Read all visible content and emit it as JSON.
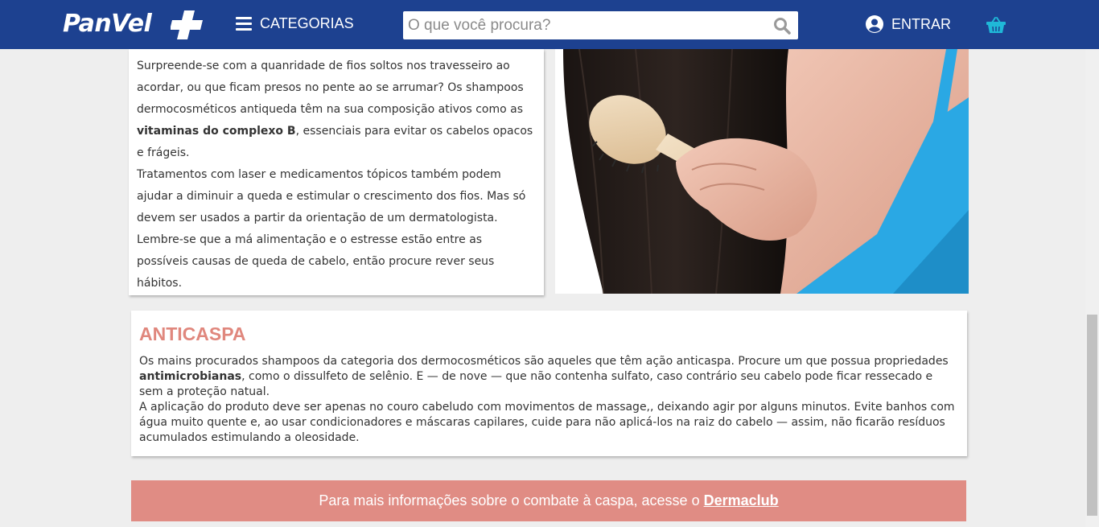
{
  "header": {
    "logo": "PanVel",
    "categories_label": "CATEGORIAS",
    "search_placeholder": "O que você procura?",
    "login_label": "ENTRAR"
  },
  "colors": {
    "header_bg": "#1d4190",
    "accent_salmon": "#e0877d",
    "cart_cyan": "#1fb8d8"
  },
  "icons": [
    "menu-icon",
    "search-icon",
    "user-icon",
    "basket-icon"
  ],
  "hair_loss_section": {
    "p1_a": "Surpreende-se com a quanridade de fios soltos nos travesseiro ao acordar, ou que ficam presos no pente ao se arrumar? Os shampoos dermocosméticos antiqueda têm na sua composição ativos como as ",
    "p1_bold": "vitaminas do complexo B",
    "p1_b": ", essenciais para evitar os cabelos opacos e frágeis.",
    "p2": "Tratamentos com laser e medicamentos tópicos também podem ajudar a diminuir a queda e estimular o crescimento dos fios. Mas só devem ser usados a partir da orientação de um dermatologista. Lembre-se que a má alimentação e o estresse estão entre as possíveis causas de queda de cabelo, então procure rever seus hábitos."
  },
  "anticaspa": {
    "title": "ANTICASPA",
    "p1_a": "Os mains procurados shampoos da categoria dos dermocosméticos são aqueles que têm ação anticaspa. Procure um que possua propriedades ",
    "p1_bold": "antimicrobianas",
    "p1_b": ", como o dissulfeto de selênio. E — de nove — que não contenha sulfato, caso contrário seu cabelo pode ficar ressecado e sem a proteção natual.",
    "p2": "A aplicação do produto deve ser apenas no couro cabeludo com movimentos de massage,, deixando agir por alguns minutos. Evite banhos com água muito quente e, ao usar condicionadores e máscaras capilares, cuide para não aplicá-los na raiz do cabelo — assim, não ficarão resíduos acumulados estimulando a oleosidade."
  },
  "banner": {
    "text": "Para mais informações sobre o combate à caspa, acesse o",
    "link": "Dermaclub"
  }
}
